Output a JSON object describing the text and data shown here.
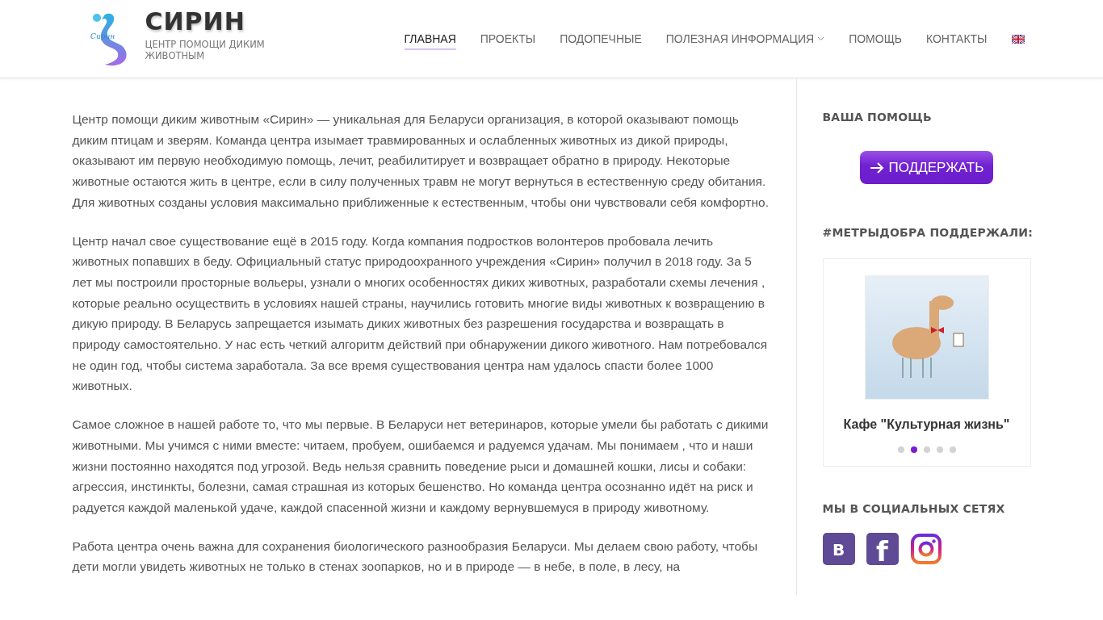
{
  "header": {
    "logo_text": "Сирин",
    "title": "СИРИН",
    "subtitle": "ЦЕНТР ПОМОЩИ ДИКИМ ЖИВОТНЫМ",
    "nav": [
      {
        "label": "ГЛАВНАЯ",
        "selected": true,
        "kind": "link"
      },
      {
        "label": "ПРОЕКТЫ",
        "selected": false,
        "kind": "link"
      },
      {
        "label": "ПОДОПЕЧНЫЕ",
        "selected": false,
        "kind": "link"
      },
      {
        "label": "ПОЛЕЗНАЯ ИНФОРМАЦИЯ",
        "selected": false,
        "kind": "dropdown"
      },
      {
        "label": "ПОМОЩЬ",
        "selected": false,
        "kind": "link"
      },
      {
        "label": "КОНТАКТЫ",
        "selected": false,
        "kind": "link"
      },
      {
        "selected": false,
        "kind": "flag"
      }
    ]
  },
  "article": {
    "paragraphs": [
      "Центр помощи диким животным «Сирин» — уникальная для Беларуси организация, в которой оказывают помощь диким птицам и зверям. Команда центра изымает травмированных и ослабленных животных из дикой природы, оказывают им первую необходимую помощь, лечит, реабилитирует и возвращает обратно в природу. Некоторые животные остаются жить в центре, если в силу полученных травм не могут вернуться в естественную среду обитания. Для животных созданы условия максимально приближенные к естественным, чтобы они чувствовали себя комфортно.",
      "Центр начал свое существование ещё в 2015 году. Когда компания подростков волонтеров пробовала лечить животных попавших в беду. Официальный статус природоохранного учреждения «Сирин» получил в 2018 году. За 5 лет мы построили просторные вольеры, узнали о многих особенностях диких животных, разработали схемы лечения , которые реально осуществить в условиях нашей страны, научились готовить многие виды животных к возвращению в дикую природу. В Беларусь запрещается изымать диких животных без разрешения государства и возвращать в природу самостоятельно. У нас есть четкий алгоритм действий при обнаружении дикого животного. Нам потребовался не один год, чтобы система заработала. За все время существования центра нам удалось спасти более 1000 животных.",
      "Самое сложное в нашей работе то, что мы первые. В Беларуси нет ветеринаров, которые умели бы работать с дикими животными. Мы учимся с ними вместе: читаем, пробуем, ошибаемся и радуемся удачам. Мы понимаем , что и наши жизни постоянно находятся под угрозой. Ведь нельзя сравнить поведение рыси и домашней кошки, лисы и собаки: агрессия, инстинкты, болезни, самая страшная из которых бешенство. Но команда центра осознанно идёт на риск и радуется каждой маленькой удаче, каждой спасенной жизни и каждому вернувшемуся в природу животному.",
      "Работа центра очень важна для сохранения биологического разнообразия Беларуси. Мы делаем свою работу, чтобы дети могли увидеть животных не только в стенах зоопарков, но и в природе — в небе, в поле, в лесу, на"
    ]
  },
  "sidebar": {
    "help_heading": "ВАША ПОМОЩЬ",
    "donate_button": "ПОДДЕРЖАТЬ",
    "supporters_heading": "#МЕТРЫДОБРА ПОДДЕРЖАЛИ:",
    "carousel": {
      "caption": "Кафе \"Культурная жизнь\"",
      "dots": [
        {
          "selected": false
        },
        {
          "selected": true
        },
        {
          "selected": false
        },
        {
          "selected": false
        },
        {
          "selected": false
        }
      ]
    },
    "social_heading": "МЫ В СОЦИАЛЬНЫХ СЕТЯХ",
    "social": [
      {
        "kind": "vk",
        "label": "В"
      },
      {
        "kind": "facebook",
        "label": "f"
      },
      {
        "kind": "instagram"
      }
    ]
  }
}
